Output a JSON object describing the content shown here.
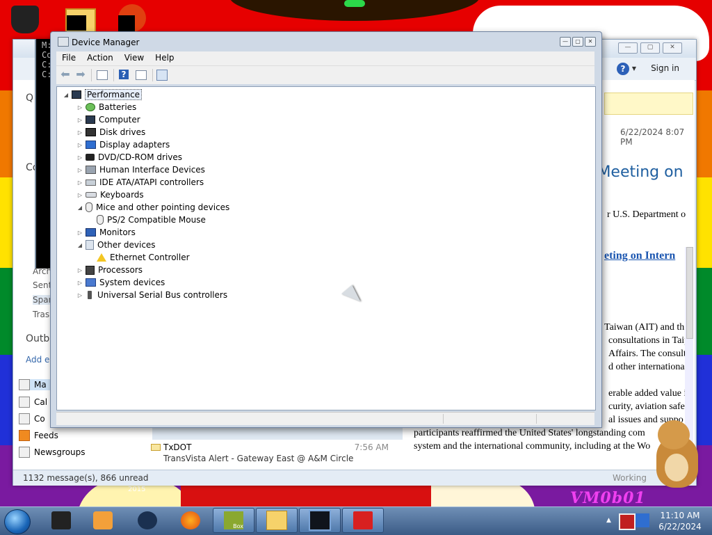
{
  "device_manager": {
    "title": "Device Manager",
    "menu": [
      "File",
      "Action",
      "View",
      "Help"
    ],
    "tree": {
      "root": "Performance",
      "categories": [
        {
          "label": "Batteries",
          "icon": "battery-icon",
          "expanded": false
        },
        {
          "label": "Computer",
          "icon": "computer-icon",
          "expanded": false
        },
        {
          "label": "Disk drives",
          "icon": "disk-drive-icon",
          "expanded": false
        },
        {
          "label": "Display adapters",
          "icon": "display-adapter-icon",
          "expanded": false
        },
        {
          "label": "DVD/CD-ROM drives",
          "icon": "dvd-drive-icon",
          "expanded": false
        },
        {
          "label": "Human Interface Devices",
          "icon": "hid-icon",
          "expanded": false
        },
        {
          "label": "IDE ATA/ATAPI controllers",
          "icon": "ide-controller-icon",
          "expanded": false
        },
        {
          "label": "Keyboards",
          "icon": "keyboard-icon",
          "expanded": false
        },
        {
          "label": "Mice and other pointing devices",
          "icon": "mouse-icon",
          "expanded": true,
          "children": [
            "PS/2 Compatible Mouse"
          ]
        },
        {
          "label": "Monitors",
          "icon": "monitor-icon",
          "expanded": false
        },
        {
          "label": "Other devices",
          "icon": "unknown-device-icon",
          "expanded": true,
          "children": [
            "Ethernet Controller"
          ]
        },
        {
          "label": "Processors",
          "icon": "processor-icon",
          "expanded": false
        },
        {
          "label": "System devices",
          "icon": "system-device-icon",
          "expanded": false
        },
        {
          "label": "Universal Serial Bus controllers",
          "icon": "usb-icon",
          "expanded": false
        }
      ]
    }
  },
  "mail_window": {
    "sign_in": "Sign in",
    "date": "6/22/2024 8:07 PM",
    "heading": "o Meeting on",
    "body_lines": [
      "r U.S. Department o",
      "eting on Intern",
      "Taiwan (AIT) and th",
      "consultations in Taip",
      "Affairs. The consulta",
      "d other international",
      "erable added value i",
      "curity, aviation safe",
      "al issues and suppo",
      "participants reaffirmed the United States' longstanding com",
      "system and the international community, including at the Wo"
    ],
    "left_pane": {
      "fragments": [
        "Q",
        "Co",
        "Arch",
        "Sent",
        "Spam",
        "Trash",
        "Outbo",
        "Add e"
      ],
      "nav": [
        "Ma",
        "Cal",
        "Co",
        "Feeds",
        "Newsgroups"
      ]
    },
    "message": {
      "from": "TxDOT",
      "time": "7:56 AM",
      "subject": "TransVista Alert - Gateway East @ A&M Circle"
    },
    "status_left": "1132 message(s), 866 unread",
    "status_right": "Working"
  },
  "console": {
    "lines": [
      "M:",
      "Co",
      "",
      "C:",
      "",
      "C:"
    ]
  },
  "desktop": {
    "watermark": "VM0b01",
    "badge_2015": "2015",
    "box_label": "Box"
  },
  "taskbar": {
    "time": "11:10 AM",
    "date": "6/22/2024"
  }
}
